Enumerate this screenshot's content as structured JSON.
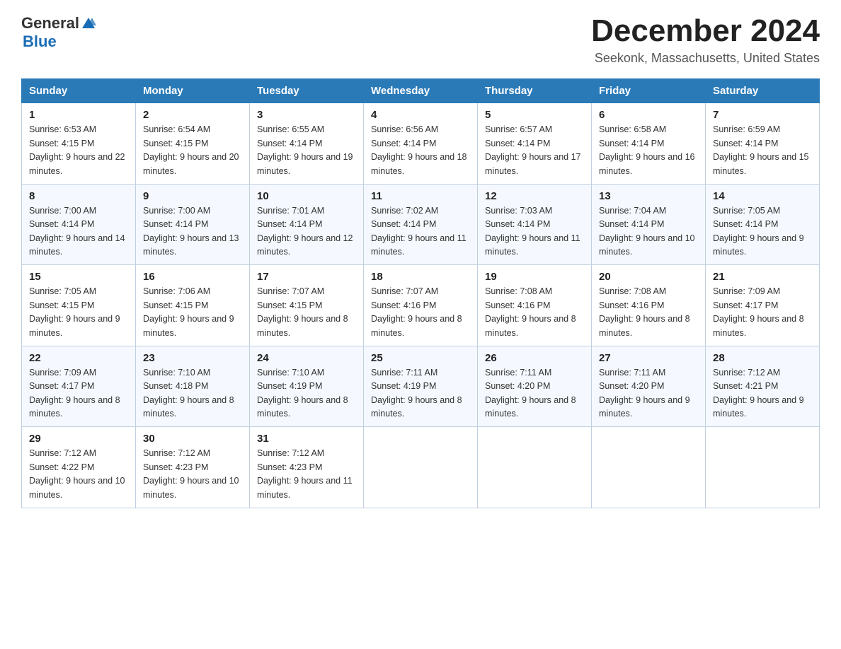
{
  "header": {
    "logo_general": "General",
    "logo_blue": "Blue",
    "month_title": "December 2024",
    "location": "Seekonk, Massachusetts, United States"
  },
  "weekdays": [
    "Sunday",
    "Monday",
    "Tuesday",
    "Wednesday",
    "Thursday",
    "Friday",
    "Saturday"
  ],
  "weeks": [
    [
      {
        "day": "1",
        "sunrise": "6:53 AM",
        "sunset": "4:15 PM",
        "daylight": "9 hours and 22 minutes."
      },
      {
        "day": "2",
        "sunrise": "6:54 AM",
        "sunset": "4:15 PM",
        "daylight": "9 hours and 20 minutes."
      },
      {
        "day": "3",
        "sunrise": "6:55 AM",
        "sunset": "4:14 PM",
        "daylight": "9 hours and 19 minutes."
      },
      {
        "day": "4",
        "sunrise": "6:56 AM",
        "sunset": "4:14 PM",
        "daylight": "9 hours and 18 minutes."
      },
      {
        "day": "5",
        "sunrise": "6:57 AM",
        "sunset": "4:14 PM",
        "daylight": "9 hours and 17 minutes."
      },
      {
        "day": "6",
        "sunrise": "6:58 AM",
        "sunset": "4:14 PM",
        "daylight": "9 hours and 16 minutes."
      },
      {
        "day": "7",
        "sunrise": "6:59 AM",
        "sunset": "4:14 PM",
        "daylight": "9 hours and 15 minutes."
      }
    ],
    [
      {
        "day": "8",
        "sunrise": "7:00 AM",
        "sunset": "4:14 PM",
        "daylight": "9 hours and 14 minutes."
      },
      {
        "day": "9",
        "sunrise": "7:00 AM",
        "sunset": "4:14 PM",
        "daylight": "9 hours and 13 minutes."
      },
      {
        "day": "10",
        "sunrise": "7:01 AM",
        "sunset": "4:14 PM",
        "daylight": "9 hours and 12 minutes."
      },
      {
        "day": "11",
        "sunrise": "7:02 AM",
        "sunset": "4:14 PM",
        "daylight": "9 hours and 11 minutes."
      },
      {
        "day": "12",
        "sunrise": "7:03 AM",
        "sunset": "4:14 PM",
        "daylight": "9 hours and 11 minutes."
      },
      {
        "day": "13",
        "sunrise": "7:04 AM",
        "sunset": "4:14 PM",
        "daylight": "9 hours and 10 minutes."
      },
      {
        "day": "14",
        "sunrise": "7:05 AM",
        "sunset": "4:14 PM",
        "daylight": "9 hours and 9 minutes."
      }
    ],
    [
      {
        "day": "15",
        "sunrise": "7:05 AM",
        "sunset": "4:15 PM",
        "daylight": "9 hours and 9 minutes."
      },
      {
        "day": "16",
        "sunrise": "7:06 AM",
        "sunset": "4:15 PM",
        "daylight": "9 hours and 9 minutes."
      },
      {
        "day": "17",
        "sunrise": "7:07 AM",
        "sunset": "4:15 PM",
        "daylight": "9 hours and 8 minutes."
      },
      {
        "day": "18",
        "sunrise": "7:07 AM",
        "sunset": "4:16 PM",
        "daylight": "9 hours and 8 minutes."
      },
      {
        "day": "19",
        "sunrise": "7:08 AM",
        "sunset": "4:16 PM",
        "daylight": "9 hours and 8 minutes."
      },
      {
        "day": "20",
        "sunrise": "7:08 AM",
        "sunset": "4:16 PM",
        "daylight": "9 hours and 8 minutes."
      },
      {
        "day": "21",
        "sunrise": "7:09 AM",
        "sunset": "4:17 PM",
        "daylight": "9 hours and 8 minutes."
      }
    ],
    [
      {
        "day": "22",
        "sunrise": "7:09 AM",
        "sunset": "4:17 PM",
        "daylight": "9 hours and 8 minutes."
      },
      {
        "day": "23",
        "sunrise": "7:10 AM",
        "sunset": "4:18 PM",
        "daylight": "9 hours and 8 minutes."
      },
      {
        "day": "24",
        "sunrise": "7:10 AM",
        "sunset": "4:19 PM",
        "daylight": "9 hours and 8 minutes."
      },
      {
        "day": "25",
        "sunrise": "7:11 AM",
        "sunset": "4:19 PM",
        "daylight": "9 hours and 8 minutes."
      },
      {
        "day": "26",
        "sunrise": "7:11 AM",
        "sunset": "4:20 PM",
        "daylight": "9 hours and 8 minutes."
      },
      {
        "day": "27",
        "sunrise": "7:11 AM",
        "sunset": "4:20 PM",
        "daylight": "9 hours and 9 minutes."
      },
      {
        "day": "28",
        "sunrise": "7:12 AM",
        "sunset": "4:21 PM",
        "daylight": "9 hours and 9 minutes."
      }
    ],
    [
      {
        "day": "29",
        "sunrise": "7:12 AM",
        "sunset": "4:22 PM",
        "daylight": "9 hours and 10 minutes."
      },
      {
        "day": "30",
        "sunrise": "7:12 AM",
        "sunset": "4:23 PM",
        "daylight": "9 hours and 10 minutes."
      },
      {
        "day": "31",
        "sunrise": "7:12 AM",
        "sunset": "4:23 PM",
        "daylight": "9 hours and 11 minutes."
      },
      null,
      null,
      null,
      null
    ]
  ]
}
